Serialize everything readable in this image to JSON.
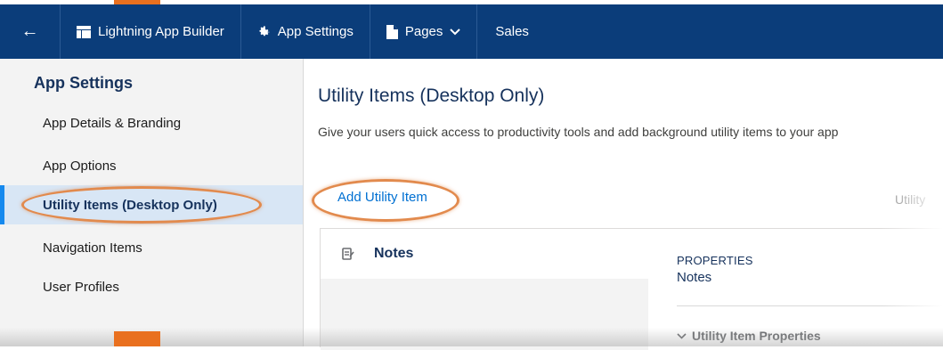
{
  "topbar": {
    "back_icon": "arrow-left-icon",
    "app_builder_label": "Lightning App Builder",
    "app_builder_icon": "app-builder-icon",
    "app_settings_label": "App Settings",
    "app_settings_icon": "gear-icon",
    "pages_label": "Pages",
    "pages_icon": "page-icon",
    "pages_chevron_icon": "chevron-down-icon",
    "sales_label": "Sales"
  },
  "sidebar": {
    "title": "App Settings",
    "items": [
      {
        "label": "App Details & Branding",
        "active": false
      },
      {
        "label": "App Options",
        "active": false
      },
      {
        "label": "Utility Items (Desktop Only)",
        "active": true
      },
      {
        "label": "Navigation Items",
        "active": false
      },
      {
        "label": "User Profiles",
        "active": false
      }
    ]
  },
  "main": {
    "title": "Utility Items (Desktop Only)",
    "description": "Give your users quick access to productivity tools and add background utility items to your app",
    "add_button": "Add Utility Item",
    "utility_truncated": "Utility",
    "panel": {
      "item_icon": "notes-icon",
      "item_name": "Notes",
      "properties_label": "PROPERTIES",
      "properties_value": "Notes",
      "section_label": "Utility Item Properties",
      "section_icon": "chevron-down-icon"
    }
  },
  "colors": {
    "topbar_bg": "#0b3d7a",
    "accent_orange": "#e9701f",
    "active_bg": "#d8e6f5",
    "active_border": "#1589ee",
    "link_blue": "#0070d2",
    "heading_navy": "#16325c",
    "highlight_oval": "#e28a4d"
  }
}
